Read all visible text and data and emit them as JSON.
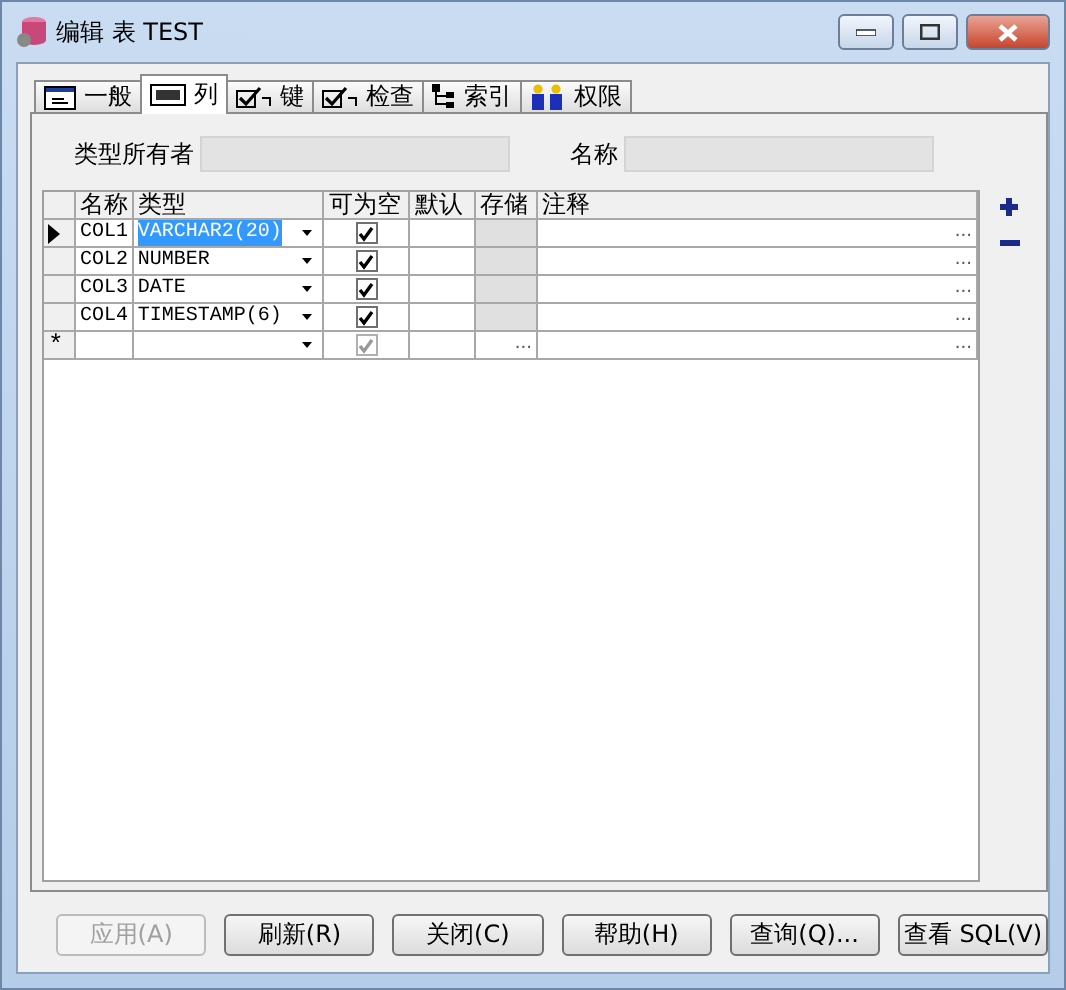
{
  "window": {
    "title": "编辑 表 TEST"
  },
  "tabs": [
    {
      "label": "一般",
      "kind": "form",
      "selected": false
    },
    {
      "label": "列",
      "kind": "col",
      "selected": true
    },
    {
      "label": "键",
      "kind": "check",
      "selected": false
    },
    {
      "label": "检查",
      "kind": "check",
      "selected": false
    },
    {
      "label": "索引",
      "kind": "tree",
      "selected": false
    },
    {
      "label": "权限",
      "kind": "people",
      "selected": false
    }
  ],
  "fields": [
    {
      "label": "类型所有者"
    },
    {
      "label": "名称"
    }
  ],
  "grid": {
    "columns": [
      "名称",
      "类型",
      "可为空",
      "默认",
      "存储",
      "注释"
    ],
    "rows": [
      {
        "name": "COL1",
        "type": "VARCHAR2(20)",
        "nullable": true,
        "selected": true,
        "comment_button": "..."
      },
      {
        "name": "COL2",
        "type": "NUMBER",
        "nullable": true,
        "selected": false,
        "comment_button": "..."
      },
      {
        "name": "COL3",
        "type": "DATE",
        "nullable": true,
        "selected": false,
        "comment_button": "..."
      },
      {
        "name": "COL4",
        "type": "TIMESTAMP(6)",
        "nullable": true,
        "selected": false,
        "comment_button": "..."
      }
    ],
    "new_row": {
      "marker": "*",
      "nullable": true,
      "storage_button": "...",
      "comment_button": "..."
    }
  },
  "buttons": [
    {
      "label": "应用(A)",
      "disabled": true
    },
    {
      "label": "刷新(R)",
      "disabled": false
    },
    {
      "label": "关闭(C)",
      "disabled": false
    },
    {
      "label": "帮助(H)",
      "disabled": false
    },
    {
      "label": "查询(Q)...",
      "disabled": false
    },
    {
      "label": "查看 SQL(V)",
      "disabled": false
    }
  ]
}
